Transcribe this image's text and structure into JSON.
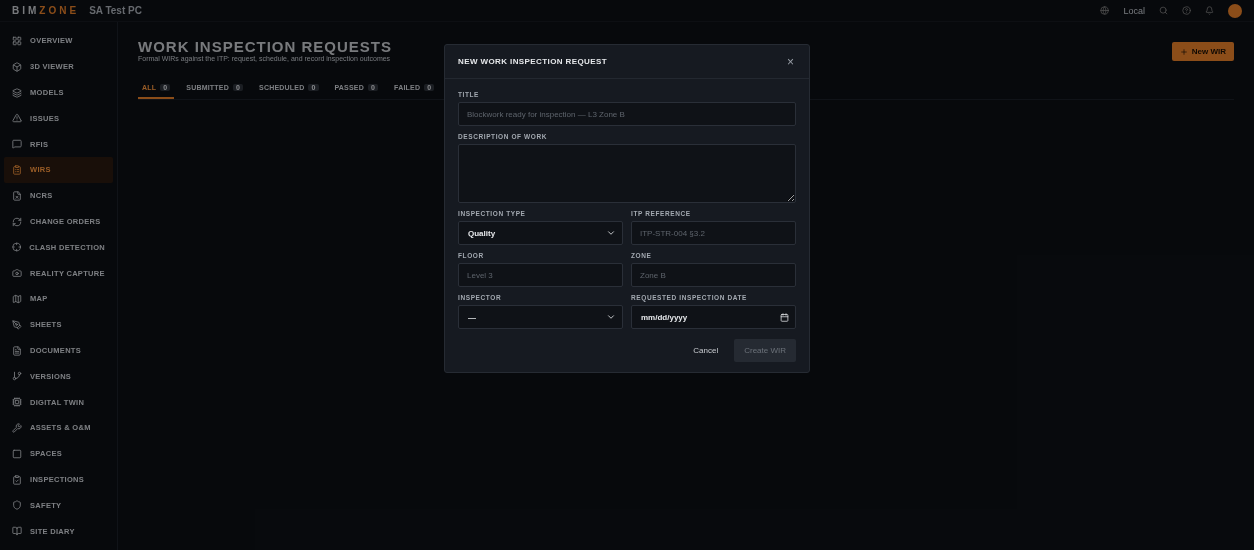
{
  "header": {
    "brand_first": "BIM",
    "brand_second": "ZONE",
    "project": "SA Test PC",
    "status": "Local"
  },
  "sidebar": {
    "items": [
      {
        "label": "OVERVIEW",
        "selected": false
      },
      {
        "label": "3D VIEWER",
        "selected": false
      },
      {
        "label": "MODELS",
        "selected": false
      },
      {
        "label": "ISSUES",
        "selected": false
      },
      {
        "label": "RFIS",
        "selected": false
      },
      {
        "label": "WIRS",
        "selected": true
      },
      {
        "label": "NCRS",
        "selected": false
      },
      {
        "label": "CHANGE ORDERS",
        "selected": false
      },
      {
        "label": "CLASH DETECTION",
        "selected": false
      },
      {
        "label": "REALITY CAPTURE",
        "selected": false
      },
      {
        "label": "MAP",
        "selected": false
      },
      {
        "label": "SHEETS",
        "selected": false
      },
      {
        "label": "DOCUMENTS",
        "selected": false
      },
      {
        "label": "VERSIONS",
        "selected": false
      },
      {
        "label": "DIGITAL TWIN",
        "selected": false
      },
      {
        "label": "ASSETS & O&M",
        "selected": false
      },
      {
        "label": "SPACES",
        "selected": false
      },
      {
        "label": "INSPECTIONS",
        "selected": false
      },
      {
        "label": "SAFETY",
        "selected": false
      },
      {
        "label": "SITE DIARY",
        "selected": false
      }
    ]
  },
  "page": {
    "title": "WORK INSPECTION REQUESTS",
    "subtitle": "Formal WIRs against the ITP: request, schedule, and record inspection outcomes",
    "new_button": "New WIR",
    "tabs": [
      {
        "label": "ALL",
        "count": "0",
        "selected": true
      },
      {
        "label": "SUBMITTED",
        "count": "0",
        "selected": false
      },
      {
        "label": "SCHEDULED",
        "count": "0",
        "selected": false
      },
      {
        "label": "PASSED",
        "count": "0",
        "selected": false
      },
      {
        "label": "FAILED",
        "count": "0",
        "selected": false
      }
    ]
  },
  "modal": {
    "title": "NEW WORK INSPECTION REQUEST",
    "close": "×",
    "rows": [
      [
        {
          "kind": "text",
          "label": "TITLE",
          "placeholder": "Blockwork ready for inspection — L3 Zone B"
        }
      ],
      [
        {
          "kind": "textarea",
          "label": "DESCRIPTION OF WORK"
        }
      ],
      [
        {
          "kind": "select",
          "label": "INSPECTION TYPE",
          "value": "Quality"
        },
        {
          "kind": "text",
          "label": "ITP REFERENCE",
          "placeholder": "ITP-STR-004 §3.2"
        }
      ],
      [
        {
          "kind": "text",
          "label": "FLOOR",
          "placeholder": "Level 3"
        },
        {
          "kind": "text",
          "label": "ZONE",
          "placeholder": "Zone B"
        }
      ],
      [
        {
          "kind": "select",
          "label": "INSPECTOR",
          "value": "—"
        },
        {
          "kind": "date",
          "label": "REQUESTED INSPECTION DATE",
          "value": "mm/dd/yyyy"
        }
      ]
    ],
    "cancel": "Cancel",
    "submit": {
      "label": "Create WIR",
      "disabled": true
    }
  }
}
